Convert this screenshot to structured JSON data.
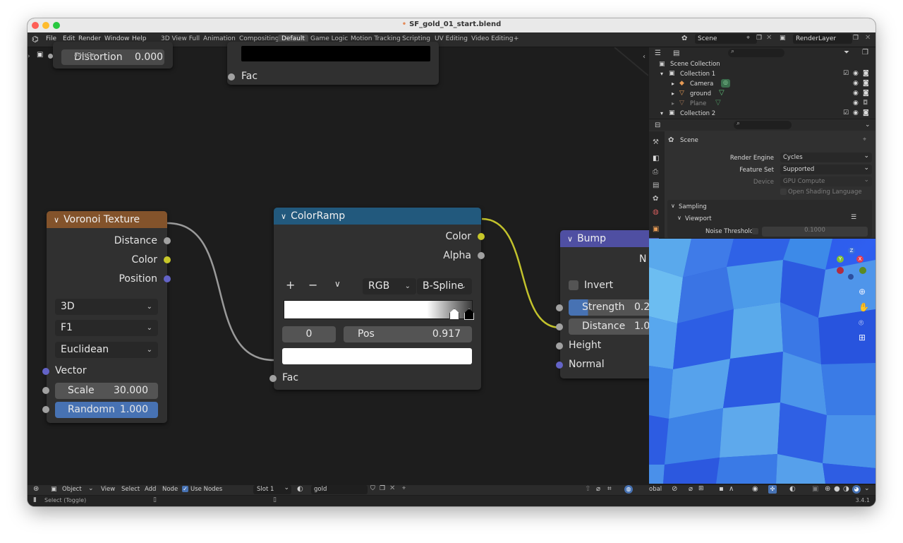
{
  "window": {
    "title": "SF_gold_01_start.blend"
  },
  "menu": [
    "File",
    "Edit",
    "Render",
    "Window",
    "Help"
  ],
  "workspaces": [
    "3D View Full",
    "Animation",
    "Compositing",
    "Default",
    "Game Logic",
    "Motion Tracking",
    "Scripting",
    "UV Editing",
    "Video Editing",
    "+"
  ],
  "active_workspace": "Default",
  "scene_selector": {
    "value": "Scene"
  },
  "layer_selector": {
    "value": "RenderLayer"
  },
  "outliner": {
    "root": "Scene Collection",
    "items": [
      {
        "label": "Collection 1"
      },
      {
        "label": "Camera"
      },
      {
        "label": "ground"
      },
      {
        "label": "Plane"
      },
      {
        "label": "Collection 2"
      }
    ]
  },
  "properties": {
    "context": "Scene",
    "render_engine_label": "Render Engine",
    "render_engine_value": "Cycles",
    "feature_set_label": "Feature Set",
    "feature_set_value": "Supported",
    "device_label": "Device",
    "device_value": "GPU Compute",
    "osl_label": "Open Shading Language",
    "sampling_label": "Sampling",
    "viewport_label": "Viewport",
    "noise_threshold_label": "Noise Threshold",
    "noise_threshold_value": "0.1000"
  },
  "top_node": {
    "fac_label": "Fac",
    "fragment_label": "Distortion",
    "fragment_value": "0.000",
    "overlay_fragment": "aderGe"
  },
  "voronoi": {
    "title": "Voronoi Texture",
    "outputs": [
      "Distance",
      "Color",
      "Position"
    ],
    "dim": "3D",
    "feature": "F1",
    "metric": "Euclidean",
    "vector_label": "Vector",
    "scale_label": "Scale",
    "scale_value": "30.000",
    "random_label": "Randomn",
    "random_value": "1.000"
  },
  "colorramp": {
    "title": "ColorRamp",
    "out_color": "Color",
    "out_alpha": "Alpha",
    "plus": "+",
    "minus": "−",
    "mode": "RGB",
    "interp": "B-Spline",
    "index": "0",
    "pos_label": "Pos",
    "pos_value": "0.917",
    "fac_label": "Fac"
  },
  "bump": {
    "title": "Bump",
    "normal_out_fragment": "N",
    "invert_label": "Invert",
    "strength_label": "Strength",
    "strength_value": "0.2",
    "distance_label": "Distance",
    "distance_value": "1.0",
    "height_label": "Height",
    "normal_label": "Normal"
  },
  "bottom_bar": {
    "mode": "Object",
    "view": "View",
    "select": "Select",
    "add": "Add",
    "node": "Node",
    "use_nodes_label": "Use Nodes",
    "slot": "Slot 1",
    "material": "gold",
    "viewport_fragment": "obal"
  },
  "status": {
    "left": "Select (Toggle)",
    "version": "3.4.1"
  },
  "colors": {
    "voronoi_header": "#83532b",
    "colorramp_header": "#22597d",
    "bump_header": "#4f4fa2",
    "yellow_socket": "#c7c729",
    "blue_socket": "#6363c7",
    "gray_socket": "#a1a1a1",
    "accent_blue": "#4772b3"
  }
}
